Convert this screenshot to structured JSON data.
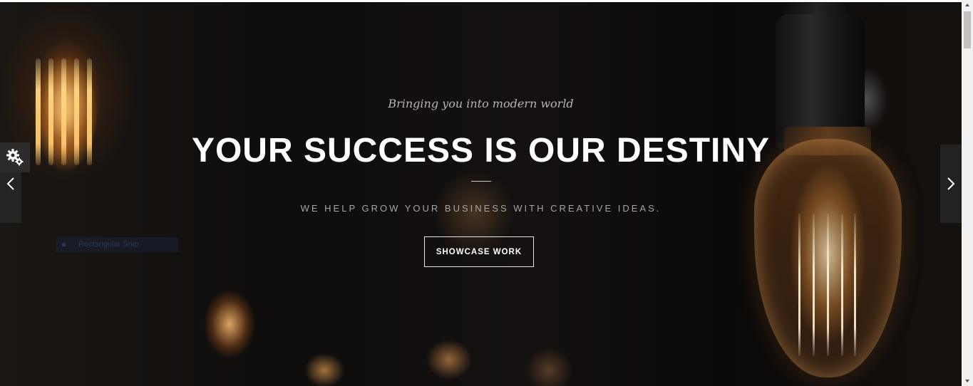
{
  "hero": {
    "tagline": "Bringing you into modern world",
    "headline": "YOUR SUCCESS IS OUR DESTINY",
    "subheadline": "WE HELP GROW YOUR BUSINESS WITH CREATIVE IDEAS.",
    "cta_label": "SHOWCASE WORK"
  },
  "overlay": {
    "snip_label": "Rectangular Snip"
  },
  "icons": {
    "settings": "gear-icon",
    "prev": "chevron-left-icon",
    "next": "chevron-right-icon"
  },
  "colors": {
    "text_primary": "#ffffff",
    "text_muted": "#a9a39d",
    "panel": "#2c2c2c"
  }
}
